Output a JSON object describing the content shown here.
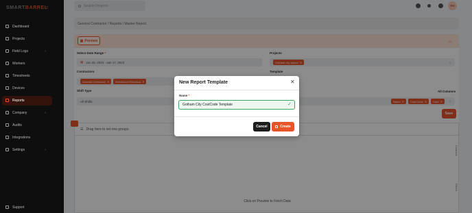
{
  "app": {
    "logo_part1": "SMART",
    "logo_part2": "BARREL"
  },
  "sidebar": {
    "items": [
      {
        "label": "Dashboard",
        "icon": "dashboard-icon"
      },
      {
        "label": "Projects",
        "icon": "projects-icon"
      },
      {
        "label": "Field Logs",
        "icon": "field-logs-icon",
        "has_children": true
      },
      {
        "label": "Workers",
        "icon": "workers-icon"
      },
      {
        "label": "Timesheets",
        "icon": "timesheets-icon"
      },
      {
        "label": "Devices",
        "icon": "devices-icon"
      },
      {
        "label": "Reports",
        "icon": "reports-icon",
        "active": true
      },
      {
        "label": "Company",
        "icon": "company-icon",
        "has_children": true
      },
      {
        "label": "Audits",
        "icon": "audits-icon"
      },
      {
        "label": "Integrations",
        "icon": "integrations-icon"
      },
      {
        "label": "Settings",
        "icon": "settings-icon",
        "has_children": true
      }
    ],
    "support_label": "Support"
  },
  "topbar": {
    "search_placeholder": "Search Projects",
    "avatar_initials": "PA"
  },
  "breadcrumb": "General Contractor  /  Reports  /  Master Report",
  "panel": {
    "preview_label": "Preview",
    "date_range_label": "Select Date Range",
    "date_range_value": "Jan 08, 2023 - Jan 17, 2023",
    "projects_label": "Projects",
    "projects_tags": [
      "Gotham city airport"
    ],
    "contractors_label": "Contractors",
    "contractors_tags": [
      "General Contractor",
      "Robinhood Electrical"
    ],
    "template_label": "Template",
    "shift_label": "Shift Type",
    "shift_value": "All Shifts",
    "columns_label": "All Columns",
    "column_tags": [
      "Name",
      "Cost Code",
      "Date"
    ],
    "save_label": "Save"
  },
  "grid": {
    "group_hint": "Drag here to set row groups",
    "empty_message": "Click on Preview to Fetch Data",
    "side_tabs": [
      "Columns",
      "Filters"
    ]
  },
  "modal": {
    "title": "New Report Template",
    "name_label": "Name",
    "name_value": "Gotham City CostCode Template",
    "cancel_label": "Cancel",
    "create_label": "Create"
  },
  "colors": {
    "accent": "#e8542a",
    "sidebar_bg": "#1b1b1b",
    "success": "#2e9a55"
  }
}
